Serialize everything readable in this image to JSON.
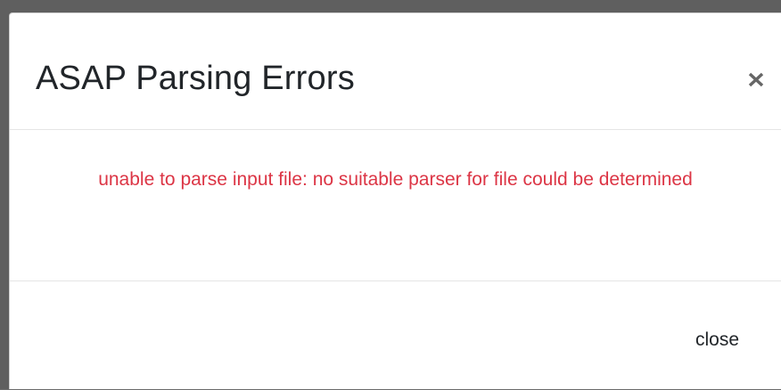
{
  "dialog": {
    "title": "ASAP Parsing Errors",
    "close_icon": "x-icon",
    "error_message": "unable to parse input file: no suitable parser for file could be determined",
    "footer": {
      "close_label": "close"
    }
  },
  "colors": {
    "error": "#dc3545",
    "backdrop": "#5f5f5f",
    "surface": "#ffffff"
  }
}
